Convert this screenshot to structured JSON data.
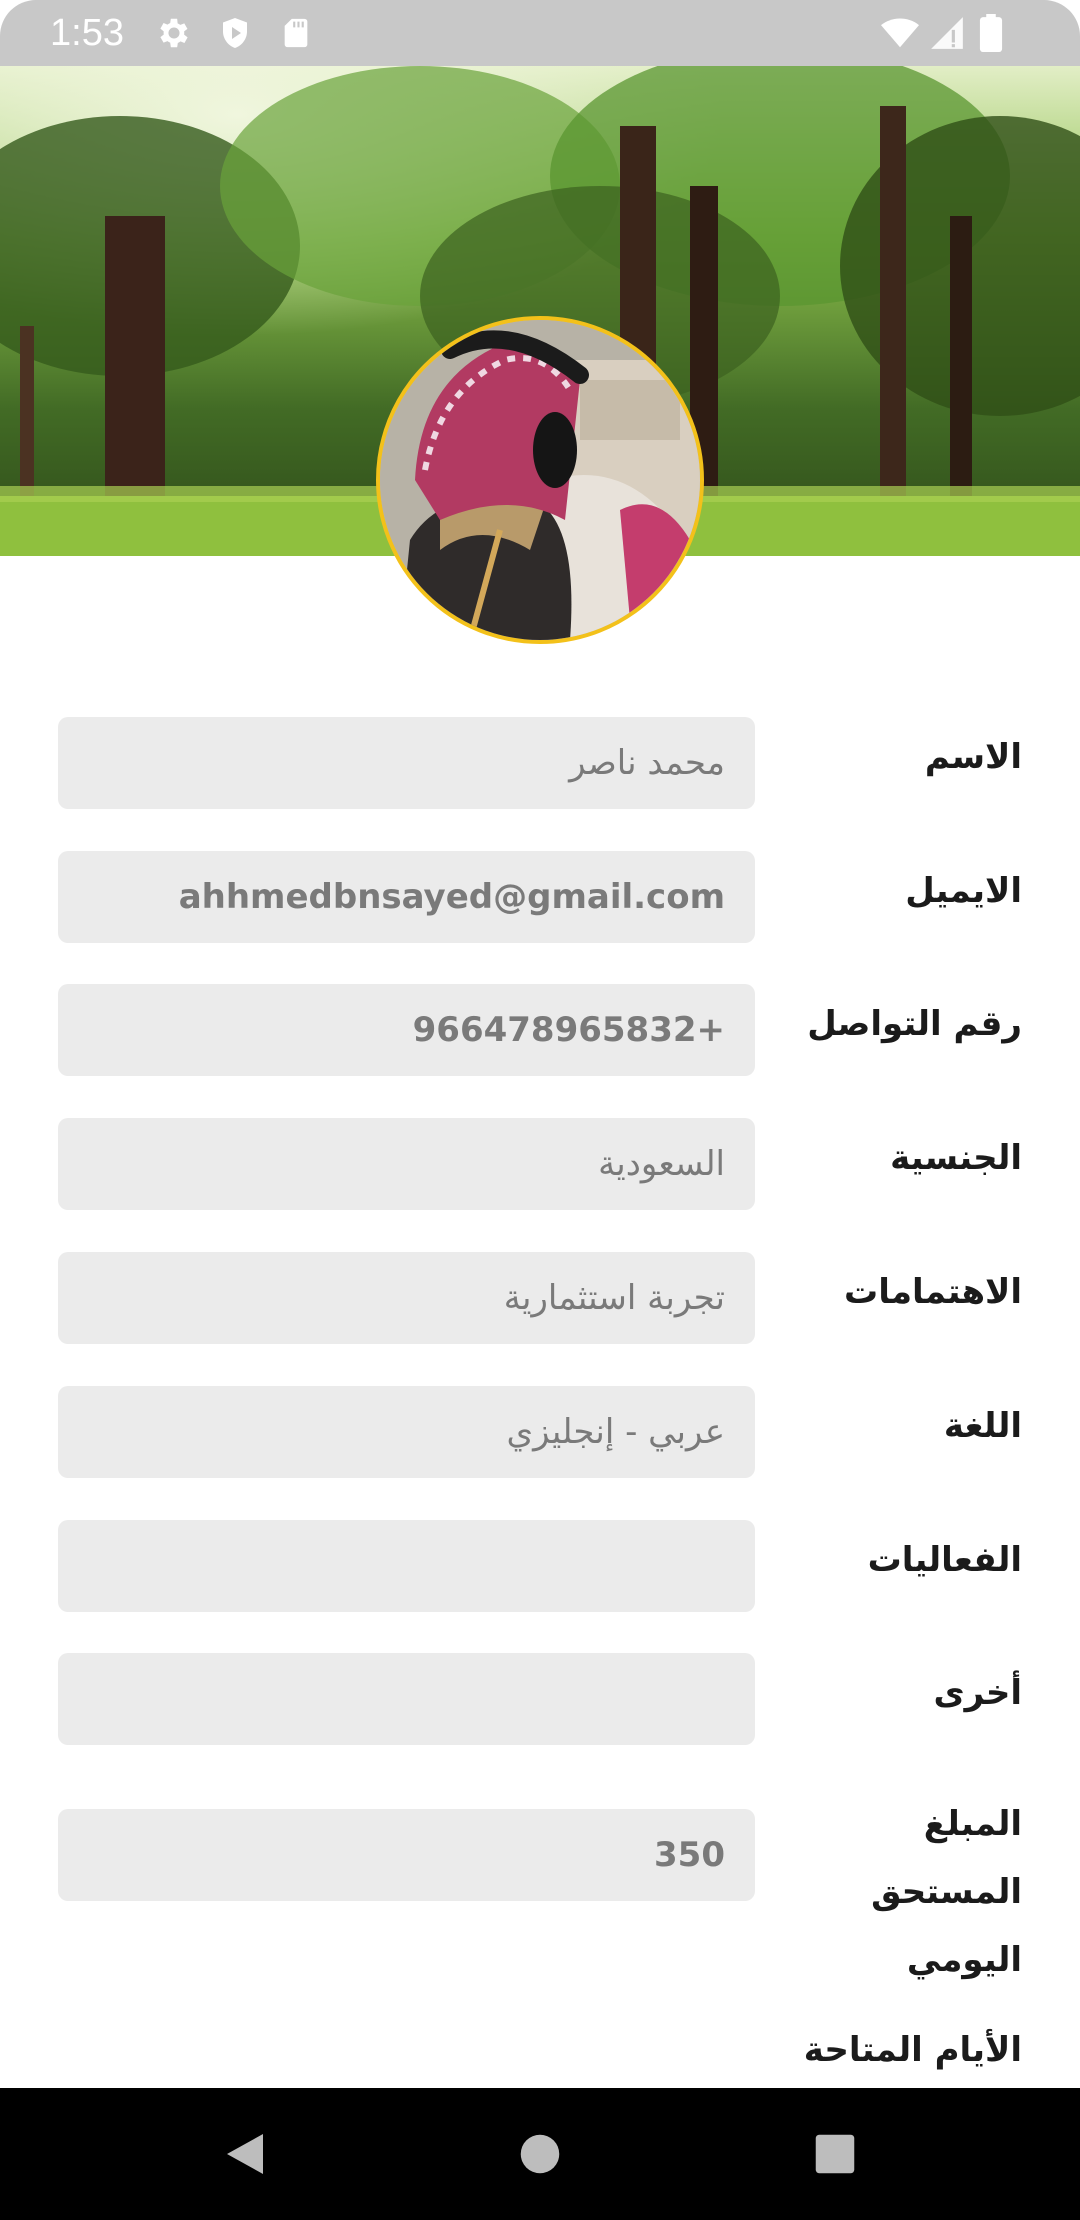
{
  "status_bar": {
    "time": "1:53",
    "icons": [
      "gear-icon",
      "shield-icon",
      "sd-card-icon",
      "wifi-icon",
      "signal-icon",
      "battery-icon"
    ]
  },
  "header": {
    "cover_image": "forest-cover",
    "avatar_image": "profile-photo"
  },
  "colors": {
    "avatar_ring": "#f3c11a",
    "field_bg": "#ebebeb",
    "label_text": "#1b1b1b",
    "value_text": "#7a7a7a"
  },
  "fields": [
    {
      "label": "الاسم",
      "value": "محمد ناصر"
    },
    {
      "label": "الايميل",
      "value": "ahhmedbnsayed@gmail.com"
    },
    {
      "label": "رقم التواصل",
      "value": "966478965832+"
    },
    {
      "label": "الجنسية",
      "value": "السعودية"
    },
    {
      "label": "الاهتمامات",
      "value": "تجربة استثمارية"
    },
    {
      "label": "اللغة",
      "value": "عربي - إنجليزي"
    },
    {
      "label": "الفعاليات",
      "value": ""
    },
    {
      "label": "أخرى",
      "value": ""
    },
    {
      "label": "المبلغ المستحق اليومي",
      "value": "350"
    }
  ],
  "available_days_label": "الأيام المتاحة",
  "nav": {
    "back": "back-icon",
    "home": "home-icon",
    "recents": "recents-icon"
  }
}
